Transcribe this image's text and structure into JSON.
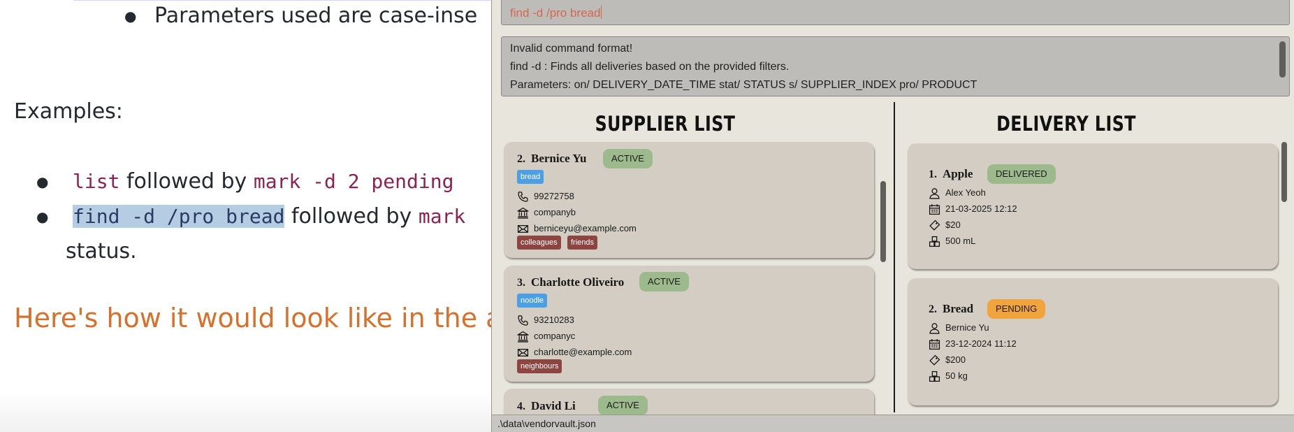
{
  "doc": {
    "top_bullet": "Parameters used are case-inse",
    "examples_heading": "Examples:",
    "example1": {
      "code1": "list",
      "text1": "followed by",
      "code2": "mark -d 2 pending"
    },
    "example2": {
      "code1": "find -d /pro bread",
      "text1": "followed by",
      "code2": "mark",
      "continuation": "status."
    },
    "section_heading": "Here's how it would look like in the a"
  },
  "app": {
    "command_input": "find -d /pro bread",
    "result_lines": [
      "Invalid command format!",
      "find -d : Finds all deliveries based on the provided filters.",
      "Parameters: on/ DELIVERY_DATE_TIME stat/ STATUS s/ SUPPLIER_INDEX pro/ PRODUCT"
    ],
    "supplier_panel": {
      "title": "SUPPLIER LIST",
      "suppliers": [
        {
          "index": "2.",
          "name": "Bernice Yu",
          "status": "ACTIVE",
          "product": "bread",
          "phone": "99272758",
          "company": "companyb",
          "email": "berniceyu@example.com",
          "tags": [
            "colleagues",
            "friends"
          ]
        },
        {
          "index": "3.",
          "name": "Charlotte Oliveiro",
          "status": "ACTIVE",
          "product": "noodle",
          "phone": "93210283",
          "company": "companyc",
          "email": "charlotte@example.com",
          "tags": [
            "neighbours"
          ]
        },
        {
          "index": "4.",
          "name": "David Li",
          "status": "ACTIVE"
        }
      ]
    },
    "delivery_panel": {
      "title": "DELIVERY LIST",
      "deliveries": [
        {
          "index": "1.",
          "product": "Apple",
          "status": "DELIVERED",
          "supplier": "Alex Yeoh",
          "datetime": "21-03-2025 12:12",
          "cost": "$20",
          "quantity": "500 mL"
        },
        {
          "index": "2.",
          "product": "Bread",
          "status": "PENDING",
          "supplier": "Bernice Yu",
          "datetime": "23-12-2024 11:12",
          "cost": "$200",
          "quantity": "50 kg"
        }
      ]
    },
    "status_bar": ".\\data\\vendorvault.json"
  }
}
